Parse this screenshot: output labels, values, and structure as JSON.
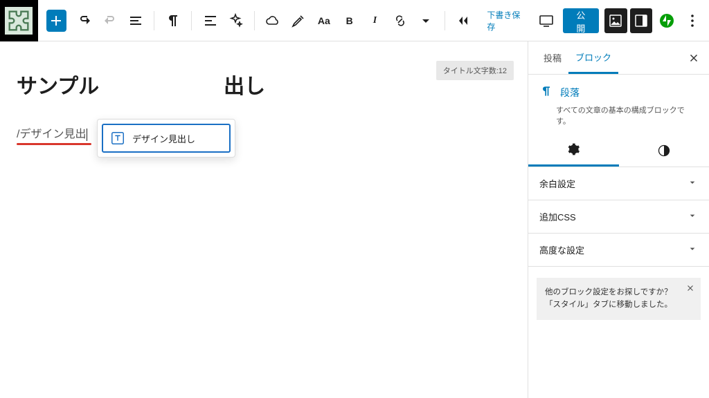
{
  "toolbar": {
    "draft_save": "下書き保存",
    "publish": "公開"
  },
  "editor": {
    "title_count_label": "タイトル文字数:12",
    "post_title_before": "サンプル",
    "post_title_after": "出し",
    "slash_input": "/デザイン見出"
  },
  "autocomplete": {
    "item_label": "デザイン見出し"
  },
  "sidebar": {
    "tabs": {
      "post": "投稿",
      "block": "ブロック"
    },
    "block": {
      "name": "段落",
      "description": "すべての文章の基本の構成ブロックです。"
    },
    "panels": {
      "spacing": "余白設定",
      "css": "追加CSS",
      "advanced": "高度な設定"
    },
    "notice": "他のブロック設定をお探しですか？「スタイル」タブに移動しました。"
  }
}
